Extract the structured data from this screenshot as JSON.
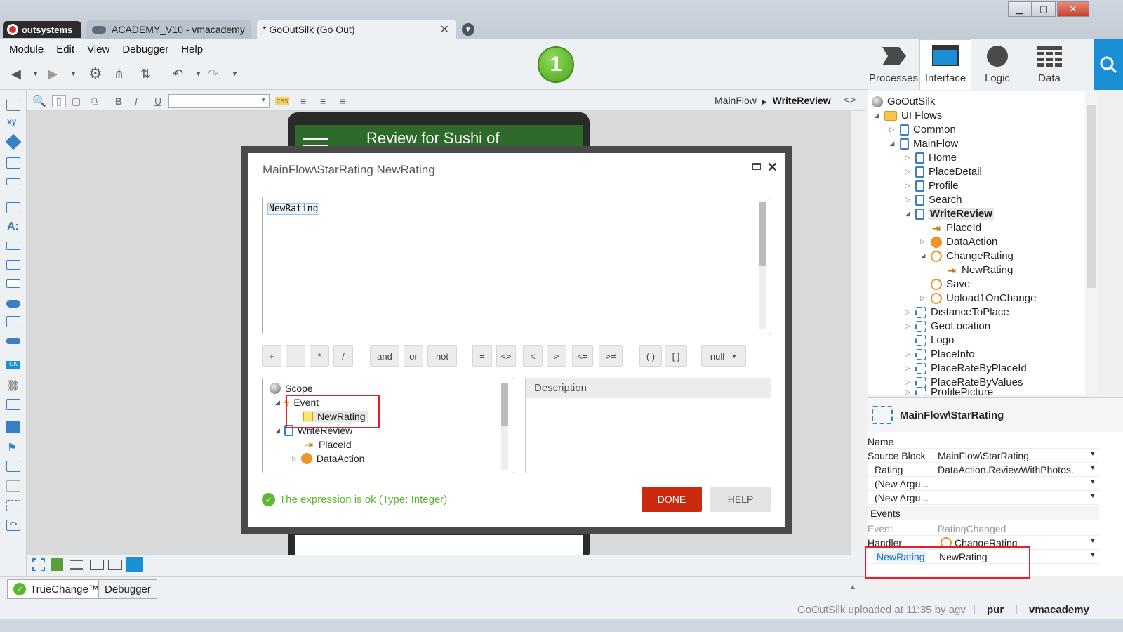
{
  "window": {
    "brand": "outsystems",
    "tabs": [
      {
        "label": "ACADEMY_V10 - vmacademy"
      },
      {
        "label": "* GoOutSilk (Go Out)"
      }
    ]
  },
  "menu": [
    "Module",
    "Edit",
    "View",
    "Debugger",
    "Help"
  ],
  "step_badge": "1",
  "right_nav": {
    "processes": "Processes",
    "interface": "Interface",
    "logic": "Logic",
    "data": "Data"
  },
  "breadcrumb": {
    "parent": "MainFlow",
    "current": "WriteReview"
  },
  "phone_header": "Review for Sushi of",
  "dialog": {
    "title": "MainFlow\\StarRating NewRating",
    "expression": "NewRating",
    "operators": [
      "+",
      "-",
      "*",
      "/",
      "and",
      "or",
      "not",
      "=",
      "<>",
      "<",
      ">",
      "<=",
      ">=",
      "( )",
      "[ ]",
      "null"
    ],
    "scope": {
      "root": "Scope",
      "event": "Event",
      "event_param": "NewRating",
      "screen": "WriteReview",
      "placeid": "PlaceId",
      "dataaction": "DataAction"
    },
    "description_label": "Description",
    "status": "The expression is ok (Type: Integer)",
    "done": "DONE",
    "help": "HELP"
  },
  "tree": {
    "module": "GoOutSilk",
    "ui_flows": "UI Flows",
    "common": "Common",
    "mainflow": "MainFlow",
    "home": "Home",
    "placedetail": "PlaceDetail",
    "profile": "Profile",
    "search": "Search",
    "writereview": "WriteReview",
    "placeid": "PlaceId",
    "dataaction": "DataAction",
    "changerating": "ChangeRating",
    "newrating": "NewRating",
    "save": "Save",
    "upload": "Upload1OnChange",
    "distance": "DistanceToPlace",
    "geolocation": "GeoLocation",
    "logo": "Logo",
    "placeinfo": "PlaceInfo",
    "placeratebyid": "PlaceRateByPlaceId",
    "placeratebyvalues": "PlaceRateByValues",
    "profilepicture": "ProfilePicture"
  },
  "props": {
    "title": "MainFlow\\StarRating",
    "rows": [
      {
        "k": "Name",
        "v": ""
      },
      {
        "k": "Source Block",
        "v": "MainFlow\\StarRating"
      },
      {
        "k": "Rating",
        "v": "DataAction.ReviewWithPhotos."
      },
      {
        "k": "(New Argu...",
        "v": ""
      },
      {
        "k": "(New Argu...",
        "v": ""
      }
    ],
    "events_label": "Events",
    "event_k": "Event",
    "event_v": "RatingChanged",
    "handler_k": "Handler",
    "handler_v": "ChangeRating",
    "newrating_k": "NewRating",
    "newrating_v": "NewRating"
  },
  "bottom_tabs": {
    "truechange": "TrueChange™",
    "debugger": "Debugger"
  },
  "status": {
    "upload": "GoOutSilk uploaded at 11:35 by agv",
    "env": "pur",
    "user": "vmacademy"
  }
}
